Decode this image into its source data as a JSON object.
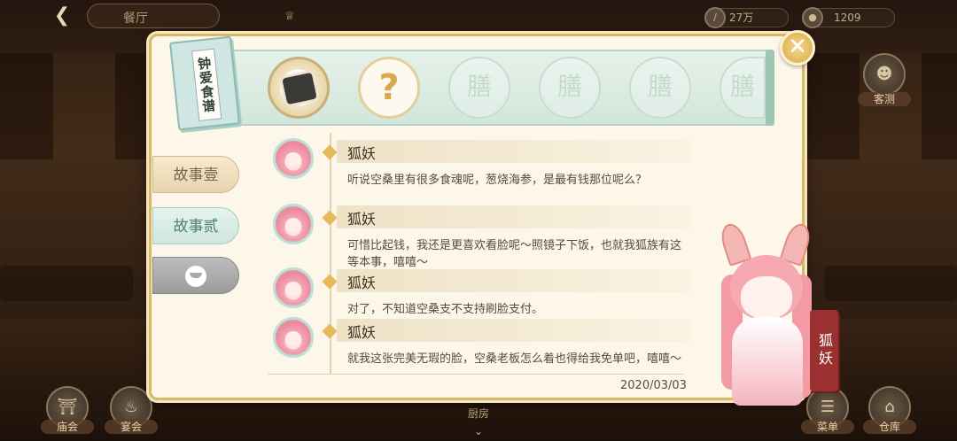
{
  "topbar": {
    "title": "餐厅",
    "back_icon": "back-arrow-icon",
    "resources": [
      {
        "name": "coin",
        "icon": "coin-icon",
        "value": "27万"
      },
      {
        "name": "gem",
        "icon": "gem-icon",
        "value": "1209"
      }
    ]
  },
  "side_buttons": {
    "right_top": {
      "label": "客测",
      "icon": "people-icon"
    },
    "bottom_left": [
      {
        "label": "庙会",
        "icon": "temple-icon"
      },
      {
        "label": "宴会",
        "icon": "banquet-icon"
      }
    ],
    "bottom_right": [
      {
        "label": "菜单",
        "icon": "menu-icon"
      },
      {
        "label": "仓库",
        "icon": "warehouse-icon"
      }
    ],
    "bottom_center": "厨房"
  },
  "panel": {
    "book_title": "钟爱食谱",
    "recipe_slots": [
      {
        "state": "unlocked",
        "icon": "sea-cucumber-dish-icon"
      },
      {
        "state": "unknown",
        "glyph": "?"
      },
      {
        "state": "locked",
        "glyph": "膳"
      },
      {
        "state": "locked",
        "glyph": "膳"
      },
      {
        "state": "locked",
        "glyph": "膳"
      },
      {
        "state": "locked",
        "glyph": "膳"
      }
    ],
    "tabs": [
      {
        "label": "故事壹",
        "state": "normal"
      },
      {
        "label": "故事贰",
        "state": "selected"
      },
      {
        "label": "",
        "state": "locked",
        "icon": "bowl-icon"
      }
    ],
    "dialogue": [
      {
        "speaker": "狐妖",
        "text": "听说空桑里有很多食魂呢，葱烧海参，是最有钱那位呢么？"
      },
      {
        "speaker": "狐妖",
        "text": "可惜比起钱，我还是更喜欢看脸呢～照镜子下饭，也就我狐族有这等本事，嘻嘻～"
      },
      {
        "speaker": "狐妖",
        "text": "对了，不知道空桑支不支持刷脸支付。"
      },
      {
        "speaker": "狐妖",
        "text": "就我这张完美无瑕的脸，空桑老板怎么着也得给我免单吧，嘻嘻～"
      }
    ],
    "date": "2020/03/03"
  },
  "character": {
    "name": "狐妖"
  },
  "colors": {
    "accent_gold": "#d9b86c",
    "panel_bg": "#fdf7e9",
    "tag_red": "#9a3030",
    "teal": "#cfe6de"
  }
}
